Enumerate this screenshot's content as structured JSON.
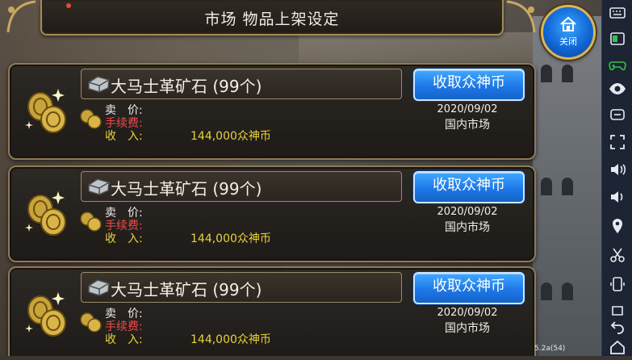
{
  "header": {
    "title": "市场 物品上架设定"
  },
  "close_button": {
    "label": "关闭"
  },
  "listings": [
    {
      "item_name": "大马士革矿石 (99个)",
      "collect_label": "收取众神币",
      "price_label": "卖　价:",
      "fee_label": "手续费:",
      "income_label": "收　入:",
      "income_value": "144,000众神币",
      "date": "2020/09/02",
      "market": "国内市场"
    },
    {
      "item_name": "大马士革矿石 (99个)",
      "collect_label": "收取众神币",
      "price_label": "卖　价:",
      "fee_label": "手续费:",
      "income_label": "收　入:",
      "income_value": "144,000众神币",
      "date": "2020/09/02",
      "market": "国内市场"
    },
    {
      "item_name": "大马士革矿石 (99个)",
      "collect_label": "收取众神币",
      "price_label": "卖　价:",
      "fee_label": "手续费:",
      "income_label": "收　入:",
      "income_value": "144,000众神币",
      "date": "2020/09/02",
      "market": "国内市场"
    }
  ],
  "version": "5.2a(54)",
  "toolbar": {
    "icons": [
      "keyboard-icon",
      "window-icon",
      "gamepad-icon",
      "eye-icon",
      "tablet-icon",
      "fullscreen-icon",
      "volume-up-icon",
      "volume-down-icon",
      "location-icon",
      "scissors-icon",
      "phone-rotate-icon",
      "screenshot-icon",
      "back-icon",
      "home-icon"
    ]
  },
  "colors": {
    "button_blue": "#1e78e8",
    "fee_red": "#ef4a4a",
    "income_yellow": "#e8d43a",
    "frame_gold": "#8f7a58"
  }
}
